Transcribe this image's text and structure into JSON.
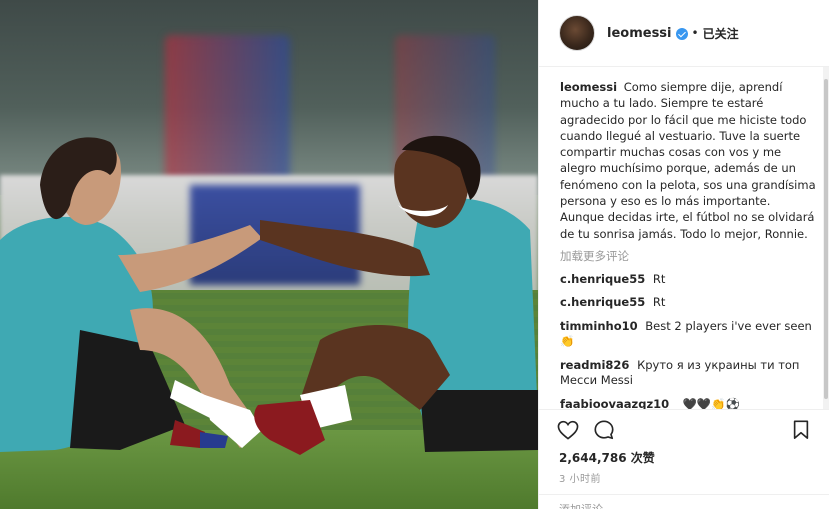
{
  "post": {
    "photo_label": "Training photo",
    "username": "leomessi",
    "verified": true,
    "follow_status": "已关注",
    "caption": "Como siempre dije, aprendí mucho a tu lado. Siempre te estaré agradecido por lo fácil que me hiciste todo cuando llegué al vestuario. Tuve la suerte compartir muchas cosas con vos y me alegro muchísimo porque, además de un fenómeno con la pelota, sos una grandísima persona y eso es lo más importante. Aunque decidas irte, el fútbol no se olvidará de tu sonrisa jamás. Todo lo mejor, Ronnie.",
    "load_more": "加载更多评论",
    "comments": [
      {
        "user": "c.henrique55",
        "text": "Rt"
      },
      {
        "user": "c.henrique55",
        "text": "Rt"
      },
      {
        "user": "timminho10",
        "text": "Best 2 players i've ever seen👏"
      },
      {
        "user": "readmi826",
        "text": "Круто я из украины ти топ Месси Messi"
      },
      {
        "user": "faabioovaazqz10_",
        "text": "🖤🖤👏⚽"
      }
    ],
    "likes": "2,644,786 次赞",
    "time": "3 小时前",
    "add_comment_placeholder": "添加评论……"
  },
  "icons": {
    "like": "heart-icon",
    "comment": "comment-icon",
    "save": "bookmark-icon"
  }
}
